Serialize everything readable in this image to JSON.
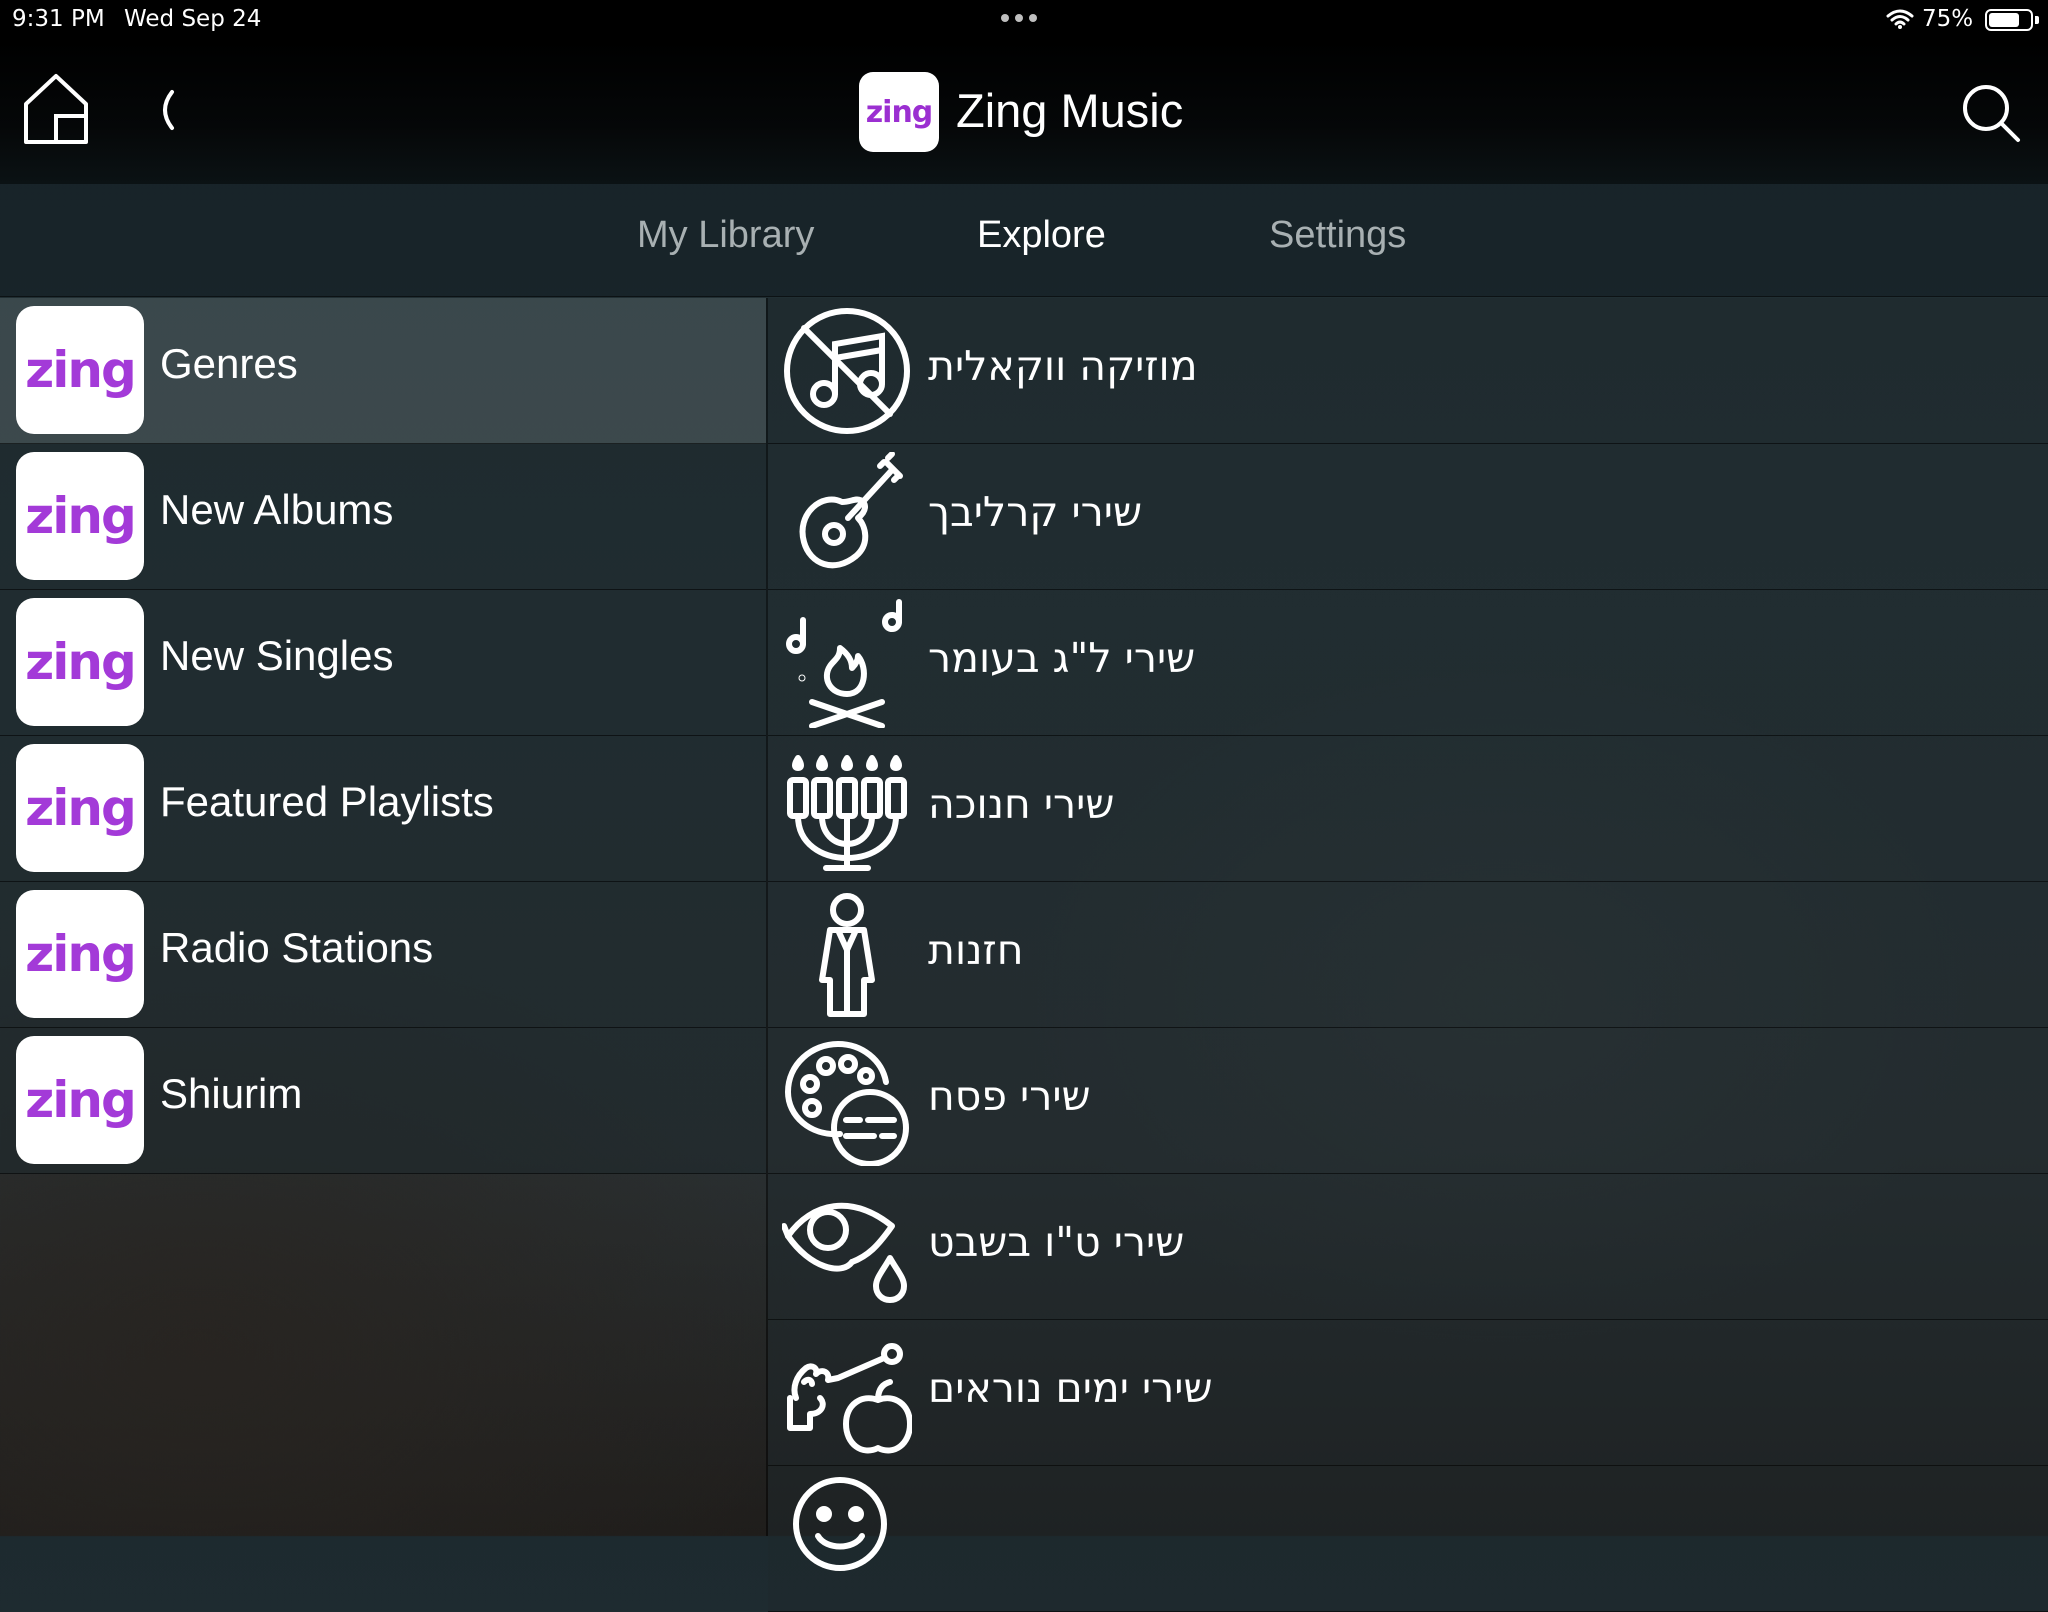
{
  "status_bar": {
    "time": "9:31 PM",
    "date": "Wed Sep 24",
    "battery_percent_label": "75%",
    "battery_level": 0.75
  },
  "header": {
    "logo_text": "zing",
    "title": "Zing Music",
    "icons": {
      "home": "home-icon",
      "back": "chevron-left-icon",
      "search": "search-icon"
    }
  },
  "tabs": [
    {
      "label": "My Library",
      "active": false
    },
    {
      "label": "Explore",
      "active": true
    },
    {
      "label": "Settings",
      "active": false
    }
  ],
  "categories": [
    {
      "logo": "zing",
      "label": "Genres",
      "selected": true
    },
    {
      "logo": "zing",
      "label": "New Albums",
      "selected": false
    },
    {
      "logo": "zing",
      "label": "New Singles",
      "selected": false
    },
    {
      "logo": "zing",
      "label": "Featured Playlists",
      "selected": false
    },
    {
      "logo": "zing",
      "label": "Radio Stations",
      "selected": false
    },
    {
      "logo": "zing",
      "label": "Shiurim",
      "selected": false
    }
  ],
  "genres": [
    {
      "label": "מוזיקה ווקאלית",
      "icon": "no-music-icon"
    },
    {
      "label": "שירי קרליבך",
      "icon": "guitar-icon"
    },
    {
      "label": "שירי ל\"ג בעומר",
      "icon": "bonfire-icon"
    },
    {
      "label": "שירי חנוכה",
      "icon": "menorah-icon"
    },
    {
      "label": "חזנות",
      "icon": "cantor-icon"
    },
    {
      "label": "שירי פסח",
      "icon": "seder-plate-icon"
    },
    {
      "label": "שירי ט\"ו בשבט",
      "icon": "eye-drop-icon"
    },
    {
      "label": "שירי ימים נוראים",
      "icon": "shofar-apple-icon"
    },
    {
      "label": "",
      "icon": "smiley-icon"
    }
  ],
  "colors": {
    "brand_purple": "#a33ad8",
    "tab_inactive": "#a8b0b2",
    "tab_active": "#ffffff"
  }
}
